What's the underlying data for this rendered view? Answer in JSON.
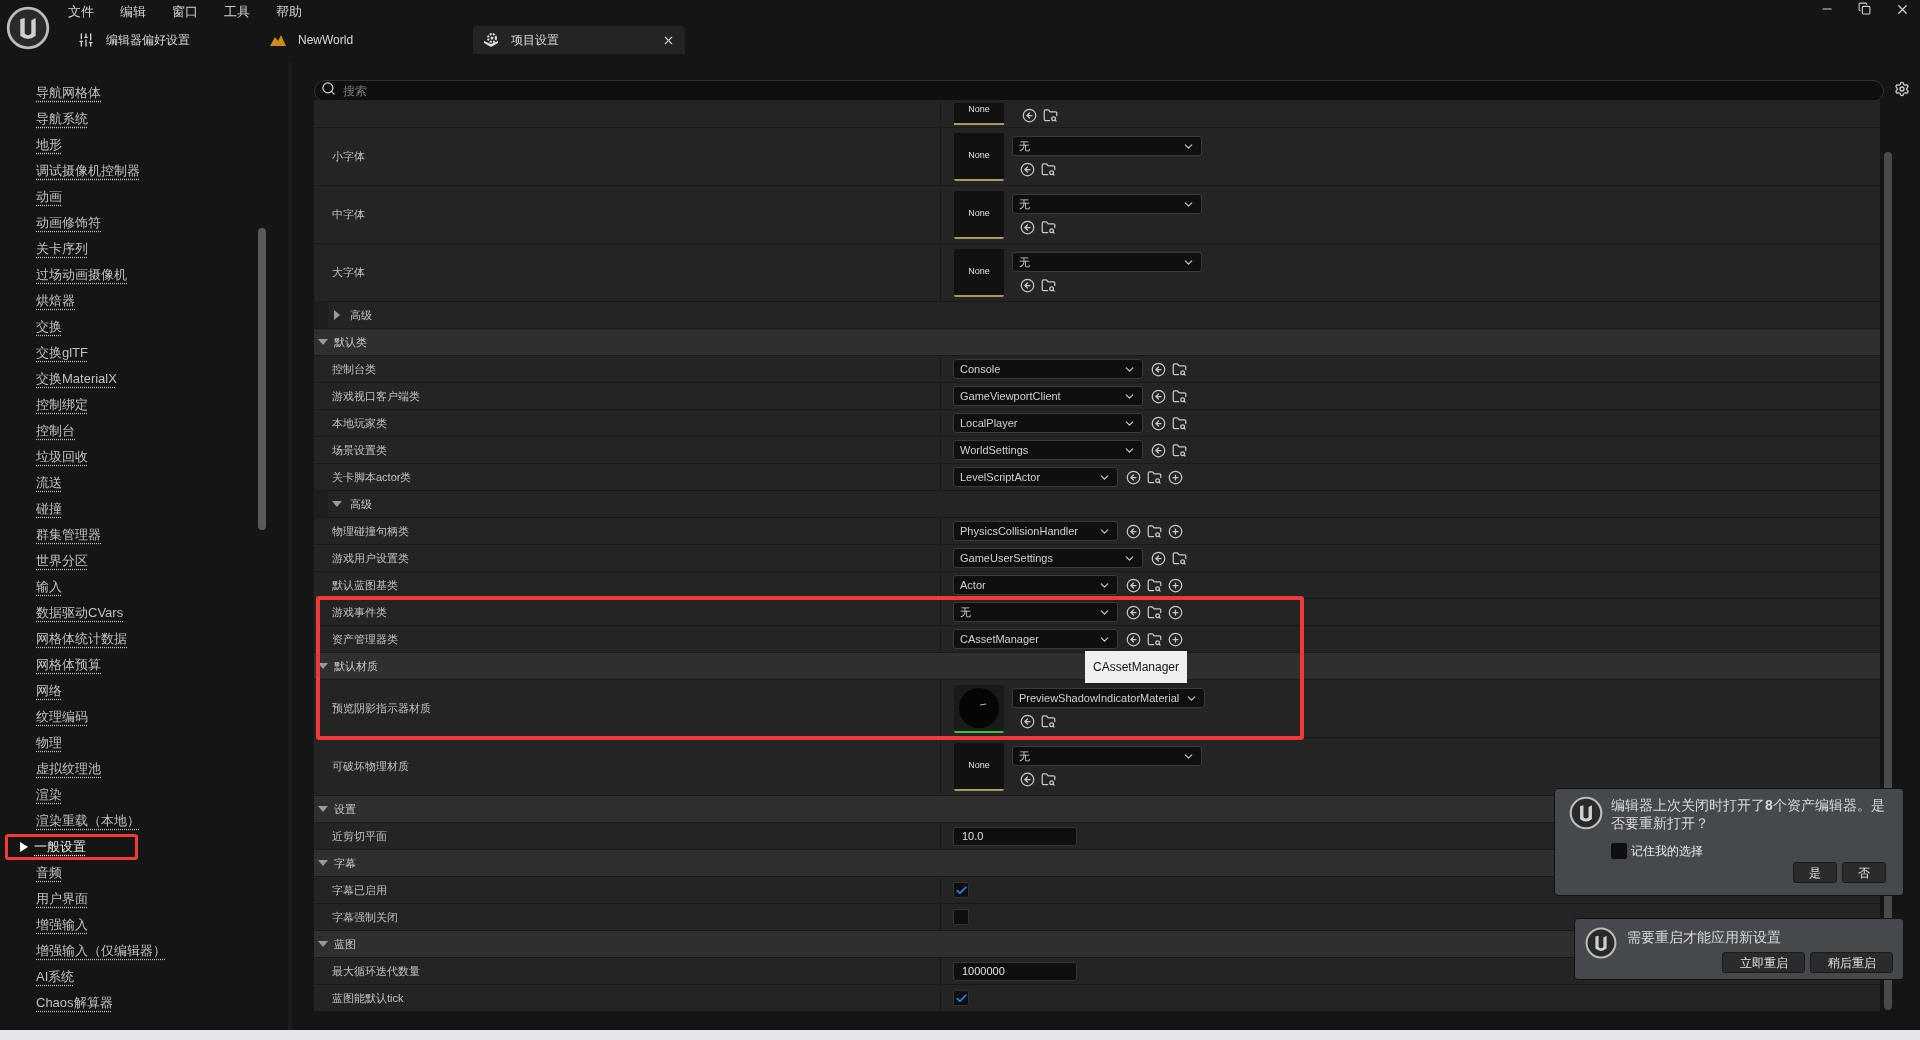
{
  "menu": [
    "文件",
    "编辑",
    "窗口",
    "工具",
    "帮助"
  ],
  "tabs": [
    {
      "label": "编辑器偏好设置",
      "kind": "prefs",
      "selected": false
    },
    {
      "label": "NewWorld",
      "kind": "level",
      "selected": false
    },
    {
      "label": "项目设置",
      "kind": "project",
      "selected": true
    }
  ],
  "search": {
    "placeholder": "搜索"
  },
  "sidebar": {
    "items": [
      {
        "label": "导航网格体",
        "selected": false
      },
      {
        "label": "导航系统",
        "selected": false
      },
      {
        "label": "地形",
        "selected": false
      },
      {
        "label": "调试摄像机控制器",
        "selected": false
      },
      {
        "label": "动画",
        "selected": false
      },
      {
        "label": "动画修饰符",
        "selected": false
      },
      {
        "label": "关卡序列",
        "selected": false
      },
      {
        "label": "过场动画摄像机",
        "selected": false
      },
      {
        "label": "烘焙器",
        "selected": false
      },
      {
        "label": "交换",
        "selected": false
      },
      {
        "label": "交换glTF",
        "selected": false
      },
      {
        "label": "交换MaterialX",
        "selected": false
      },
      {
        "label": "控制绑定",
        "selected": false
      },
      {
        "label": "控制台",
        "selected": false
      },
      {
        "label": "垃圾回收",
        "selected": false
      },
      {
        "label": "流送",
        "selected": false
      },
      {
        "label": "碰撞",
        "selected": false
      },
      {
        "label": "群集管理器",
        "selected": false
      },
      {
        "label": "世界分区",
        "selected": false
      },
      {
        "label": "输入",
        "selected": false
      },
      {
        "label": "数据驱动CVars",
        "selected": false
      },
      {
        "label": "网格体统计数据",
        "selected": false
      },
      {
        "label": "网格体预算",
        "selected": false
      },
      {
        "label": "网络",
        "selected": false
      },
      {
        "label": "纹理编码",
        "selected": false
      },
      {
        "label": "物理",
        "selected": false
      },
      {
        "label": "虚拟纹理池",
        "selected": false
      },
      {
        "label": "渲染",
        "selected": false
      },
      {
        "label": "渲染重载（本地）",
        "selected": false
      },
      {
        "label": "一般设置",
        "selected": true
      },
      {
        "label": "音频",
        "selected": false
      },
      {
        "label": "用户界面",
        "selected": false
      },
      {
        "label": "增强输入",
        "selected": false
      },
      {
        "label": "增强输入（仅编辑器）",
        "selected": false
      },
      {
        "label": "AI系统",
        "selected": false
      },
      {
        "label": "Chaos解算器",
        "selected": false
      }
    ]
  },
  "properties": [
    {
      "kind": "asset_clipped",
      "thumb": "None"
    },
    {
      "kind": "asset",
      "label": "小字体",
      "thumb": "None",
      "value": "无"
    },
    {
      "kind": "asset",
      "label": "中字体",
      "thumb": "None",
      "value": "无"
    },
    {
      "kind": "asset",
      "label": "大字体",
      "thumb": "None",
      "value": "无"
    },
    {
      "kind": "group",
      "label": "高级",
      "expanded": false
    },
    {
      "kind": "category",
      "label": "默认类",
      "expanded": true
    },
    {
      "kind": "class",
      "label": "控制台类",
      "value": "Console",
      "add_button": false
    },
    {
      "kind": "class",
      "label": "游戏视口客户端类",
      "value": "GameViewportClient",
      "add_button": false
    },
    {
      "kind": "class",
      "label": "本地玩家类",
      "value": "LocalPlayer",
      "add_button": false
    },
    {
      "kind": "class",
      "label": "场景设置类",
      "value": "WorldSettings",
      "add_button": false
    },
    {
      "kind": "class",
      "label": "关卡脚本actor类",
      "value": "LevelScriptActor",
      "add_button": true
    },
    {
      "kind": "group",
      "label": "高级",
      "expanded": true
    },
    {
      "kind": "class",
      "label": "物理碰撞句柄类",
      "value": "PhysicsCollisionHandler",
      "add_button": true
    },
    {
      "kind": "class",
      "label": "游戏用户设置类",
      "value": "GameUserSettings",
      "add_button": false
    },
    {
      "kind": "class",
      "label": "默认蓝图基类",
      "value": "Actor",
      "add_button": true
    },
    {
      "kind": "class",
      "label": "游戏事件类",
      "value": "无",
      "add_button": true
    },
    {
      "kind": "class",
      "label": "资产管理器类",
      "value": "CAssetManager",
      "add_button": true,
      "tooltip": "CAssetManager"
    },
    {
      "kind": "category",
      "label": "默认材质",
      "expanded": true
    },
    {
      "kind": "asset",
      "label": "预览阴影指示器材质",
      "value": "PreviewShadowIndicatorMaterial"
    },
    {
      "kind": "asset",
      "label": "可破坏物理材质",
      "thumb": "None",
      "value": "无"
    },
    {
      "kind": "category",
      "label": "设置",
      "expanded": true
    },
    {
      "kind": "number",
      "label": "近剪切平面",
      "value": "10.0"
    },
    {
      "kind": "category",
      "label": "字幕",
      "expanded": true
    },
    {
      "kind": "checkbox",
      "label": "字幕已启用",
      "checked": true
    },
    {
      "kind": "checkbox",
      "label": "字幕强制关闭",
      "checked": false
    },
    {
      "kind": "category",
      "label": "蓝图",
      "expanded": true
    },
    {
      "kind": "number",
      "label": "最大循环迭代数量",
      "value": "1000000"
    },
    {
      "kind": "checkbox",
      "label": "蓝图能默认tick",
      "checked": true
    }
  ],
  "notifications": [
    {
      "kind": "reopen",
      "message": "编辑器上次关闭时打开了**8**个资产编辑器。是否要重新打开？",
      "checkbox": {
        "label": "记住我的选择",
        "checked": false
      },
      "buttons": [
        "是",
        "否"
      ]
    },
    {
      "kind": "restart",
      "message": "需要重启才能应用新设置",
      "buttons": [
        "立即重启",
        "稍后重启"
      ]
    }
  ]
}
